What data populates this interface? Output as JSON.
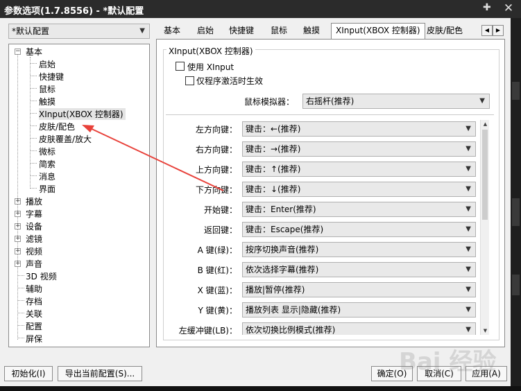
{
  "window": {
    "title": "参数选项(1.7.8556) - *默认配置",
    "pin_icon": "pin-icon",
    "close_icon": "close-icon"
  },
  "profile": {
    "selected": "*默认配置"
  },
  "tree": {
    "basic": {
      "label": "基本",
      "children": [
        "启始",
        "快捷键",
        "鼠标",
        "触摸",
        "XInput(XBOX 控制器)",
        "皮肤/配色",
        "皮肤覆盖/放大",
        "微标",
        "简索",
        "消息",
        "界面"
      ]
    },
    "top": [
      "播放",
      "字幕",
      "设备",
      "滤镜",
      "视频",
      "声音"
    ],
    "leaf": [
      "3D 视频",
      "辅助",
      "存档",
      "关联",
      "配置",
      "屏保"
    ]
  },
  "tabs": [
    "基本",
    "启始",
    "快捷键",
    "鼠标",
    "触摸",
    "XInput(XBOX 控制器)",
    "皮肤/配色"
  ],
  "active_tab": "XInput(XBOX 控制器)",
  "group": {
    "title": "XInput(XBOX 控制器)",
    "use_xinput": "使用 XInput",
    "only_active": "仅程序激活时生效",
    "mouse_sim_label": "鼠标模拟器：",
    "mouse_sim_value": "右摇杆(推荐)"
  },
  "mappings": [
    {
      "label": "左方向键：",
      "value": "键击：←(推荐)"
    },
    {
      "label": "右方向键：",
      "value": "键击：→(推荐)"
    },
    {
      "label": "上方向键：",
      "value": "键击：↑(推荐)"
    },
    {
      "label": "下方向键：",
      "value": "键击：↓(推荐)"
    },
    {
      "label": "开始键：",
      "value": "键击：Enter(推荐)"
    },
    {
      "label": "返回键：",
      "value": "键击：Escape(推荐)"
    },
    {
      "label": "A 键(绿)：",
      "value": "按序切换声音(推荐)"
    },
    {
      "label": "B 键(红)：",
      "value": "依次选择字幕(推荐)"
    },
    {
      "label": "X 键(蓝)：",
      "value": "播放|暂停(推荐)"
    },
    {
      "label": "Y 键(黄)：",
      "value": "播放列表 显示|隐藏(推荐)"
    },
    {
      "label": "左缓冲键(LB)：",
      "value": "依次切换比例模式(推荐)"
    }
  ],
  "buttons": {
    "init": "初始化(I)",
    "export": "导出当前配置(S)...",
    "ok": "确定(O)",
    "cancel": "取消(C)",
    "apply": "应用(A)"
  },
  "watermark": "Bai 经验",
  "colors": {
    "titlebar": "#2b2b2b",
    "annotation_arrow": "#e8413a"
  }
}
